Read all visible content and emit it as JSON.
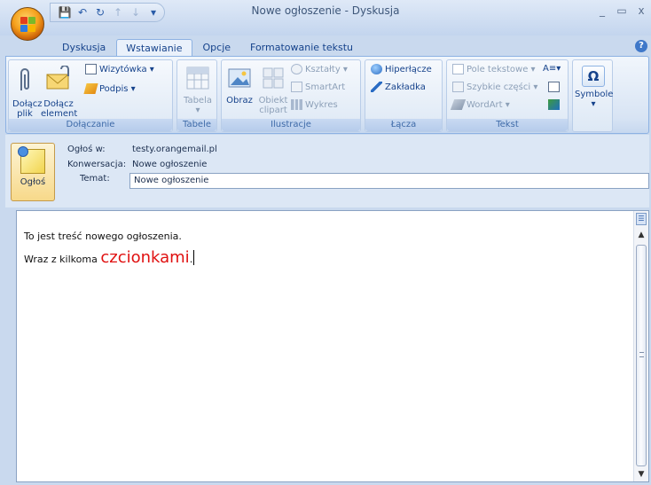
{
  "window": {
    "title": "Nowe ogłoszenie - Dyskusja",
    "controls": {
      "minimize": "_",
      "maximize": "▭",
      "close": "x"
    }
  },
  "quick_access": {
    "save_icon": "save-icon",
    "undo_icon": "undo-icon",
    "redo_icon": "redo-icon",
    "prev_icon": "up-arrow-icon",
    "next_icon": "down-arrow-icon",
    "customize": "▾"
  },
  "tabs": [
    {
      "label": "Dyskusja"
    },
    {
      "label": "Wstawianie"
    },
    {
      "label": "Opcje"
    },
    {
      "label": "Formatowanie tekstu"
    }
  ],
  "active_tab": "Wstawianie",
  "ribbon": {
    "dolaczanie": {
      "label": "Dołączanie",
      "attach_file": "Dołącz plik",
      "attach_item": "Dołącz element",
      "business_card": "Wizytówka ▾",
      "signature": "Podpis ▾"
    },
    "tabele": {
      "label": "Tabele",
      "table": "Tabela",
      "table_arrow": "▾"
    },
    "ilustracje": {
      "label": "Ilustracje",
      "picture": "Obraz",
      "clipart": "Obiekt clipart",
      "shapes": "Kształty ▾",
      "smartart": "SmartArt",
      "chart": "Wykres"
    },
    "lacza": {
      "label": "Łącza",
      "hyperlink": "Hiperłącze",
      "bookmark": "Zakładka"
    },
    "tekst": {
      "label": "Tekst",
      "text_box": "Pole tekstowe ▾",
      "quick_parts": "Szybkie części ▾",
      "wordart": "WordArt ▾",
      "dropcap": "A≡▾"
    },
    "symbole": {
      "label": "Symbole",
      "symbol_glyph": "Ω",
      "arrow": "▾"
    }
  },
  "header": {
    "post_button": "Ogłoś",
    "post_to_label": "Ogłoś w:",
    "post_to_value": "testy.orangemail.pl",
    "conversation_label": "Konwersacja:",
    "conversation_value": "Nowe ogłoszenie",
    "subject_label": "Temat:",
    "subject_value": "Nowe ogłoszenie"
  },
  "body": {
    "line1": "To jest treść nowego ogłoszenia.",
    "line2_prefix": "Wraz z kilkoma ",
    "line2_highlight": "czcionkami",
    "line2_suffix": ".",
    "highlight_color": "#e01010"
  }
}
